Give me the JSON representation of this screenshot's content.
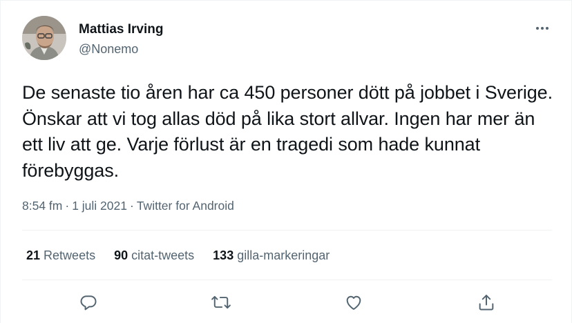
{
  "author": {
    "name": "Mattias Irving",
    "handle": "@Nonemo"
  },
  "tweet": {
    "text": "De senaste tio åren har ca 450 personer dött på jobbet i Sverige. Önskar att vi tog allas död på lika stort allvar. Ingen har mer än ett liv att ge. Varje förlust är en tragedi som hade kunnat förebyggas.",
    "time": "8:54 fm",
    "date": "1 juli 2021",
    "source": "Twitter for Android",
    "separator": "·"
  },
  "stats": {
    "retweets": {
      "count": "21",
      "label": "Retweets"
    },
    "quotes": {
      "count": "90",
      "label": "citat-tweets"
    },
    "likes": {
      "count": "133",
      "label": "gilla-markeringar"
    }
  },
  "icons": {
    "more": "more-horizontal-icon",
    "reply": "reply-icon",
    "retweet": "retweet-icon",
    "like": "heart-icon",
    "share": "share-icon"
  },
  "colors": {
    "text_primary": "#0f1419",
    "text_secondary": "#536471",
    "divider": "#eff3f4"
  }
}
